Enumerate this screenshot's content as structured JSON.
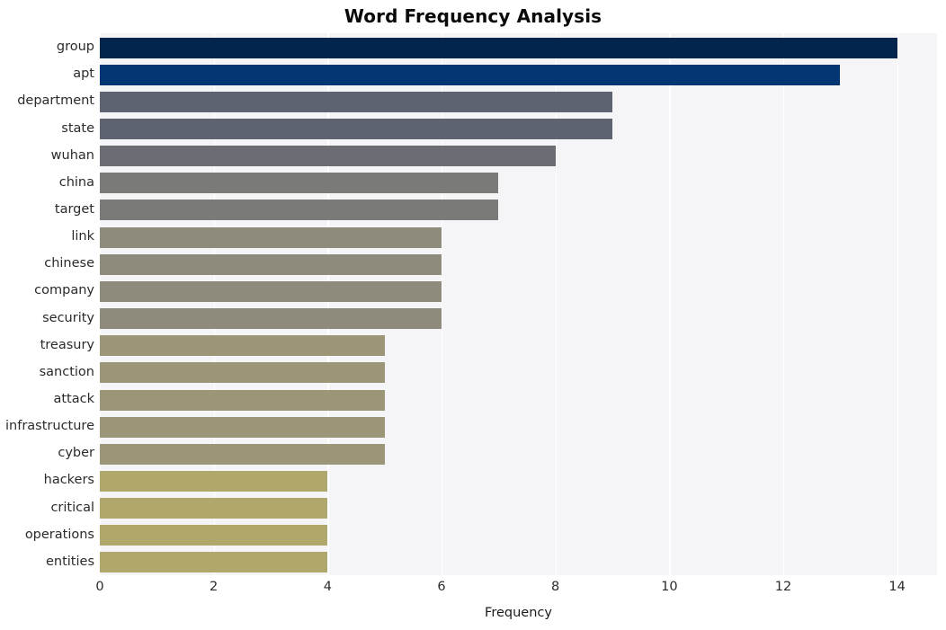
{
  "chart_data": {
    "type": "bar",
    "orientation": "horizontal",
    "title": "Word Frequency Analysis",
    "xlabel": "Frequency",
    "ylabel": "",
    "categories": [
      "group",
      "apt",
      "department",
      "state",
      "wuhan",
      "china",
      "target",
      "link",
      "chinese",
      "company",
      "security",
      "treasury",
      "sanction",
      "attack",
      "infrastructure",
      "cyber",
      "hackers",
      "critical",
      "operations",
      "entities"
    ],
    "values": [
      14,
      13,
      9,
      9,
      8,
      7,
      7,
      6,
      6,
      6,
      6,
      5,
      5,
      5,
      5,
      5,
      4,
      4,
      4,
      4
    ],
    "bar_colors": [
      "#03244c",
      "#033672",
      "#5e6371",
      "#5e6371",
      "#6a6d73",
      "#7a7a78",
      "#7a7a78",
      "#8e8b7c",
      "#8e8b7c",
      "#8e8b7c",
      "#8e8b7c",
      "#9c9678",
      "#9c9678",
      "#9c9678",
      "#9c9678",
      "#9c9678",
      "#b0a76c",
      "#b0a76c",
      "#b0a76c",
      "#b0a76c"
    ],
    "xticks": [
      0,
      2,
      4,
      6,
      8,
      10,
      12,
      14
    ],
    "xtick_labels": [
      "0",
      "2",
      "4",
      "6",
      "8",
      "10",
      "12",
      "14"
    ],
    "xlim": [
      0,
      14.7
    ],
    "grid": true,
    "grid_axis": "x",
    "grid_color": "#ffffff",
    "plot_background": "#f5f5f7",
    "figure_background": "#ffffff",
    "legend": null
  }
}
